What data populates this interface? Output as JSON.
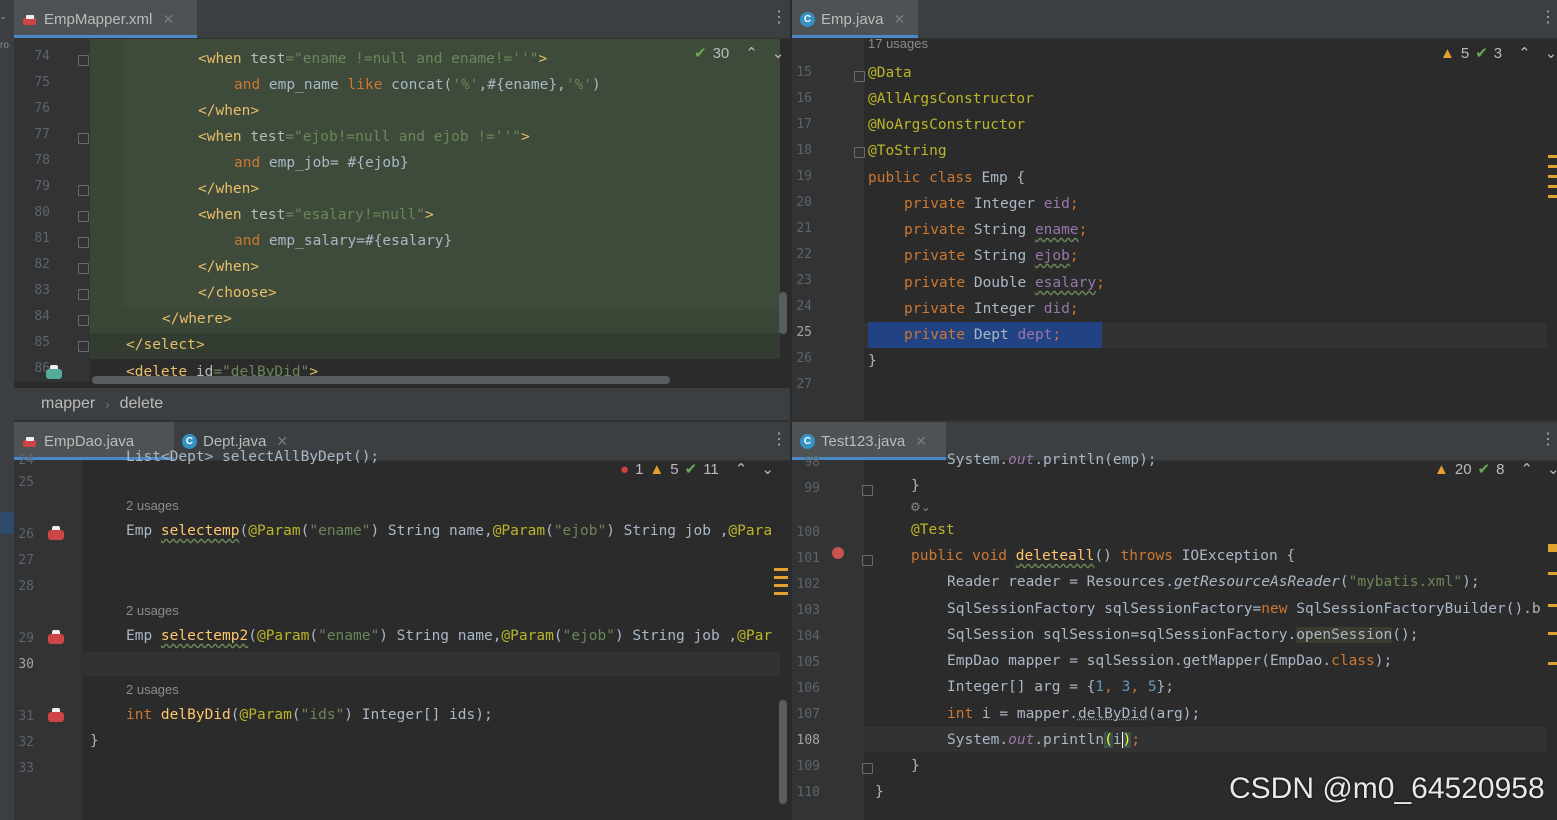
{
  "top_left": {
    "tab": "EmpMapper.xml",
    "inspections": {
      "ok": "30"
    },
    "gutter_lines": [
      "74",
      "75",
      "76",
      "77",
      "78",
      "79",
      "80",
      "81",
      "82",
      "83",
      "84",
      "85",
      "86"
    ],
    "breadcrumb": [
      "mapper",
      "delete"
    ],
    "code": {
      "l74a": "<when ",
      "l74b": "test",
      "l74c": "=",
      "l74d": "\"ename !=null and ename!=''\"",
      "l74e": ">",
      "l75a": "and",
      "l75b": " emp_name ",
      "l75c": "like",
      "l75d": " concat(",
      "l75e": "'%'",
      "l75f": ",#{ename},",
      "l75g": "'%'",
      "l75h": ")",
      "l76": "</when>",
      "l77a": "<when ",
      "l77b": "test",
      "l77c": "=",
      "l77d": "\"ejob!=null and ejob !=''\"",
      "l77e": ">",
      "l78a": "and",
      "l78b": " emp_job= #{ejob}",
      "l79": "</when>",
      "l80a": "<when ",
      "l80b": "test",
      "l80c": "=",
      "l80d": "\"esalary!=null\"",
      "l80e": ">",
      "l81a": "and",
      "l81b": " emp_salary=#{esalary}",
      "l82": "</when>",
      "l83": "</choose>",
      "l84": "</where>",
      "l85": "</select>",
      "l86a": "<delete ",
      "l86b": "id",
      "l86c": "=",
      "l86d": "\"delByDid\"",
      "l86e": ">"
    }
  },
  "top_right": {
    "tab": "Emp.java",
    "usages": "17 usages",
    "inspections": {
      "warn": "5",
      "ok": "3"
    },
    "gutter_lines": [
      "15",
      "16",
      "17",
      "18",
      "19",
      "20",
      "21",
      "22",
      "23",
      "24",
      "25",
      "26",
      "27"
    ],
    "code": {
      "l15": "@Data",
      "l16": "@AllArgsConstructor",
      "l17": "@NoArgsConstructor",
      "l18": "@ToString",
      "l19a": "public class",
      "l19b": " Emp {",
      "l20a": "private",
      "l20b": " Integer ",
      "l20c": "eid",
      "l20d": ";",
      "l21a": "private",
      "l21b": " String ",
      "l21c": "ename",
      "l21d": ";",
      "l22a": "private",
      "l22b": " String ",
      "l22c": "ejob",
      "l22d": ";",
      "l23a": "private",
      "l23b": " Double ",
      "l23c": "esalary",
      "l23d": ";",
      "l24a": "private",
      "l24b": " Integer ",
      "l24c": "did",
      "l24d": ";",
      "l25a": "private",
      "l25b": " Dept ",
      "l25c": "dept",
      "l25d": ";",
      "l26": "}"
    }
  },
  "bottom_left": {
    "tabs": [
      "EmpDao.java",
      "Dept.java"
    ],
    "inspections": {
      "err": "1",
      "warn": "5",
      "ok": "11"
    },
    "gutter_lines": [
      "24",
      "25",
      "26",
      "27",
      "28",
      "29",
      "30",
      "31",
      "32",
      "33"
    ],
    "code": {
      "l24": "List<Dept> selectAllByDept();",
      "u26": "2 usages",
      "l26a": "Emp ",
      "l26b": "selectemp",
      "l26c": "(",
      "l26d": "@Param",
      "l26e": "(",
      "l26f": "\"ename\"",
      "l26g": ") String name,",
      "l26h": "@Param",
      "l26i": "(",
      "l26j": "\"ejob\"",
      "l26k": ") String job ,",
      "l26l": "@Para",
      "u29": "2 usages",
      "l29a": "Emp ",
      "l29b": "selectemp2",
      "l29c": "(",
      "l29d": "@Param",
      "l29e": "(",
      "l29f": "\"ename\"",
      "l29g": ") String name,",
      "l29h": "@Param",
      "l29i": "(",
      "l29j": "\"ejob\"",
      "l29k": ") String job ,",
      "l29l": "@Par",
      "u31": "2 usages",
      "l31a": "int ",
      "l31b": "delByDid",
      "l31c": "(",
      "l31d": "@Param",
      "l31e": "(",
      "l31f": "\"ids\"",
      "l31g": ") Integer[] ids);",
      "l32": "}"
    }
  },
  "bottom_right": {
    "tab": "Test123.java",
    "inspections": {
      "warn": "20",
      "ok": "8"
    },
    "gutter_lines": [
      "98",
      "99",
      "100",
      "101",
      "102",
      "103",
      "104",
      "105",
      "106",
      "107",
      "108",
      "109",
      "110"
    ],
    "code": {
      "l98a": "System.",
      "l98b": "out",
      "l98c": ".println(emp);",
      "l99": "}",
      "l100": "@Test",
      "l101a": "public void ",
      "l101b": "deleteall",
      "l101c": "() ",
      "l101d": "throws",
      "l101e": " IOException {",
      "l102a": "Reader reader = Resources.",
      "l102b": "getResourceAsReader",
      "l102c": "(",
      "l102d": "\"mybatis.xml\"",
      "l102e": ");",
      "l103a": "SqlSessionFactory sqlSessionFactory=",
      "l103b": "new",
      "l103c": " SqlSessionFactoryBuilder().b",
      "l104a": "SqlSession sqlSession=sqlSessionFactory.",
      "l104b": "openSession",
      "l104c": "();",
      "l105a": "EmpDao mapper = sqlSession.getMapper(EmpDao.",
      "l105b": "class",
      "l105c": ");",
      "l106a": "Integer[] arg = {",
      "l106b": "1",
      "l106c": ", ",
      "l106d": "3",
      "l106e": ", ",
      "l106f": "5",
      "l106g": "};",
      "l107a": "int",
      "l107b": " i = mapper.",
      "l107c": "delByDid",
      "l107d": "(arg);",
      "l108a": "System.",
      "l108b": "out",
      "l108c": ".println",
      "l108d": "(",
      "l108e": "i",
      "l108f": ")",
      "l108g": ";",
      "l109": "}",
      "l110": "}"
    }
  },
  "watermark": "CSDN @m0_64520958"
}
